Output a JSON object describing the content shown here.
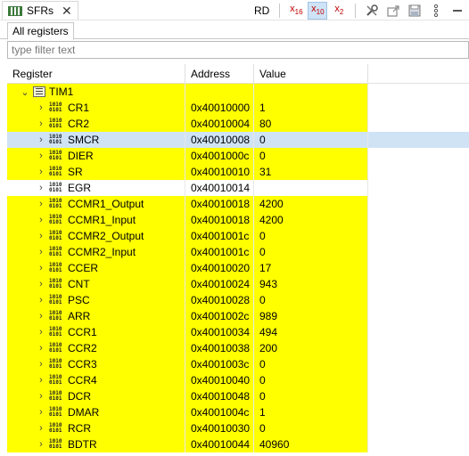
{
  "view_tab": {
    "label": "SFRs",
    "icon": "register-view-icon"
  },
  "toolbar": {
    "rd": "RD",
    "hex": {
      "text": "x",
      "sub": "16"
    },
    "dec": {
      "text": "x",
      "sub": "10"
    },
    "bin": {
      "text": "x",
      "sub": "2"
    }
  },
  "subtab": "All registers",
  "filter": {
    "placeholder": "type filter text",
    "value": ""
  },
  "columns": {
    "register": "Register",
    "address": "Address",
    "value": "Value"
  },
  "group": {
    "name": "TIM1"
  },
  "rows": [
    {
      "name": "CR1",
      "address": "0x40010000",
      "value": "1",
      "hl": "yel"
    },
    {
      "name": "CR2",
      "address": "0x40010004",
      "value": "80",
      "hl": "yel"
    },
    {
      "name": "SMCR",
      "address": "0x40010008",
      "value": "0",
      "hl": "sel"
    },
    {
      "name": "DIER",
      "address": "0x4001000c",
      "value": "0",
      "hl": "yel"
    },
    {
      "name": "SR",
      "address": "0x40010010",
      "value": "31",
      "hl": "yel"
    },
    {
      "name": "EGR",
      "address": "0x40010014",
      "value": "",
      "hl": "none"
    },
    {
      "name": "CCMR1_Output",
      "address": "0x40010018",
      "value": "4200",
      "hl": "yel"
    },
    {
      "name": "CCMR1_Input",
      "address": "0x40010018",
      "value": "4200",
      "hl": "yel"
    },
    {
      "name": "CCMR2_Output",
      "address": "0x4001001c",
      "value": "0",
      "hl": "yel"
    },
    {
      "name": "CCMR2_Input",
      "address": "0x4001001c",
      "value": "0",
      "hl": "yel"
    },
    {
      "name": "CCER",
      "address": "0x40010020",
      "value": "17",
      "hl": "yel"
    },
    {
      "name": "CNT",
      "address": "0x40010024",
      "value": "943",
      "hl": "yel"
    },
    {
      "name": "PSC",
      "address": "0x40010028",
      "value": "0",
      "hl": "yel"
    },
    {
      "name": "ARR",
      "address": "0x4001002c",
      "value": "989",
      "hl": "yel"
    },
    {
      "name": "CCR1",
      "address": "0x40010034",
      "value": "494",
      "hl": "yel"
    },
    {
      "name": "CCR2",
      "address": "0x40010038",
      "value": "200",
      "hl": "yel"
    },
    {
      "name": "CCR3",
      "address": "0x4001003c",
      "value": "0",
      "hl": "yel"
    },
    {
      "name": "CCR4",
      "address": "0x40010040",
      "value": "0",
      "hl": "yel"
    },
    {
      "name": "DCR",
      "address": "0x40010048",
      "value": "0",
      "hl": "yel"
    },
    {
      "name": "DMAR",
      "address": "0x4001004c",
      "value": "1",
      "hl": "yel"
    },
    {
      "name": "RCR",
      "address": "0x40010030",
      "value": "0",
      "hl": "yel"
    },
    {
      "name": "BDTR",
      "address": "0x40010044",
      "value": "40960",
      "hl": "yel"
    }
  ]
}
